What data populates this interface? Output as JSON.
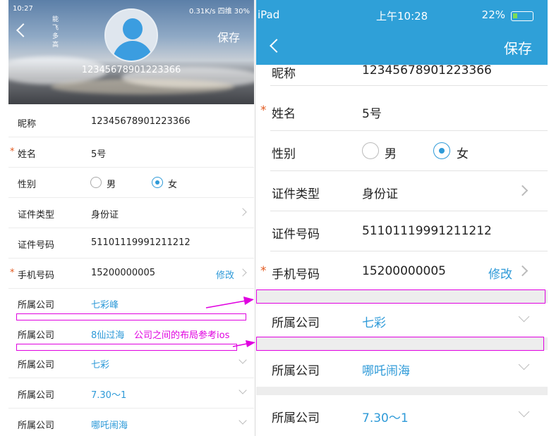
{
  "left": {
    "status_time": "10:27",
    "status_right": "0.31K/s  四维  30%",
    "header_vertical_text": "能飞多高",
    "save": "保存",
    "account_id": "12345678901223366",
    "rows": {
      "nickname_label": "昵称",
      "nickname_value": "12345678901223366",
      "name_label": "姓名",
      "name_value": "5号",
      "gender_label": "性别",
      "gender_male": "男",
      "gender_female": "女",
      "id_type_label": "证件类型",
      "id_type_value": "身份证",
      "id_no_label": "证件号码",
      "id_no_value": "51101119991211212",
      "phone_label": "手机号码",
      "phone_value": "15200000005",
      "phone_edit": "修改",
      "company_label": "所属公司",
      "company1": "七彩峰",
      "company2": "8仙过海",
      "company3": "七彩",
      "company4": "7.30～1",
      "company5": "哪吒闹海"
    },
    "annotation": "公司之间的布局参考ios",
    "required_star": "*"
  },
  "right": {
    "status_left": "iPad",
    "status_time": "上午10:28",
    "status_battery": "22%",
    "save": "保存",
    "rows": {
      "nickname_label": "昵称",
      "nickname_value": "12345678901223366",
      "name_label": "姓名",
      "name_value": "5号",
      "gender_label": "性别",
      "gender_male": "男",
      "gender_female": "女",
      "id_type_label": "证件类型",
      "id_type_value": "身份证",
      "id_no_label": "证件号码",
      "id_no_value": "51101119991211212",
      "phone_label": "手机号码",
      "phone_value": "15200000005",
      "phone_edit": "修改",
      "company_label": "所属公司",
      "company1": "七彩",
      "company2": "哪吒闹海",
      "company3": "7.30～1"
    },
    "required_star": "*"
  },
  "colors": {
    "accent": "#2e9ad8",
    "annotation": "#e000e0",
    "required": "#e25a20",
    "ios_bar": "#2fa0d8"
  }
}
